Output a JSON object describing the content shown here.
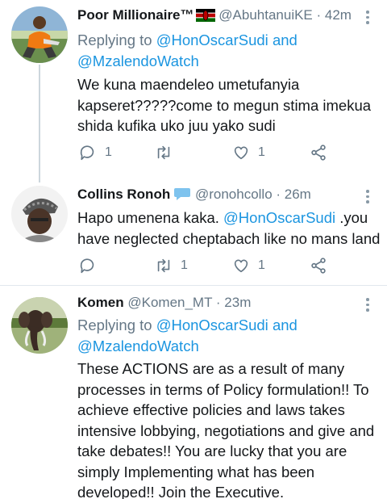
{
  "tweets": [
    {
      "name": "Poor Millionaire™",
      "handle": "@AbuhtanuiKE",
      "time": "· 42m",
      "replying_prefix": "Replying to ",
      "replying_to": [
        "@HonOscarSudi",
        "and",
        "@MzalendoWatch"
      ],
      "lines": [
        "We kuna maendeleo umetufanyia",
        "kapseret?????come to megun stima imekua",
        "shida kufika uko juu yako sudi"
      ],
      "reply_count": "1",
      "retweet_count": "",
      "like_count": "1"
    },
    {
      "name": "Collins Ronoh",
      "handle": "@ronohcollo",
      "time": "· 26m",
      "line1_pre": "Hapo umenena kaka. ",
      "line1_mention": "@HonOscarSudi",
      "line1_post": " .you",
      "line2": "have neglected cheptabach like no mans land",
      "reply_count": "",
      "retweet_count": "1",
      "like_count": "1"
    },
    {
      "name": "Komen",
      "handle": "@Komen_MT",
      "time": "· 23m",
      "replying_prefix": "Replying to ",
      "replying_to": [
        "@HonOscarSudi",
        "and",
        "@MzalendoWatch"
      ],
      "lines": [
        "These ACTIONS are as a result of many",
        "processes in terms of Policy formulation!! To",
        "achieve effective policies and laws takes",
        "intensive lobbying, negotiations and give and",
        "take debates!! You are lucky that you are",
        "simply Implementing what has been",
        "developed!! Join the Executive."
      ]
    }
  ],
  "colors": {
    "link": "#1b95e0",
    "muted": "#657786",
    "text": "#14171a",
    "divider": "#e1e8ed"
  }
}
